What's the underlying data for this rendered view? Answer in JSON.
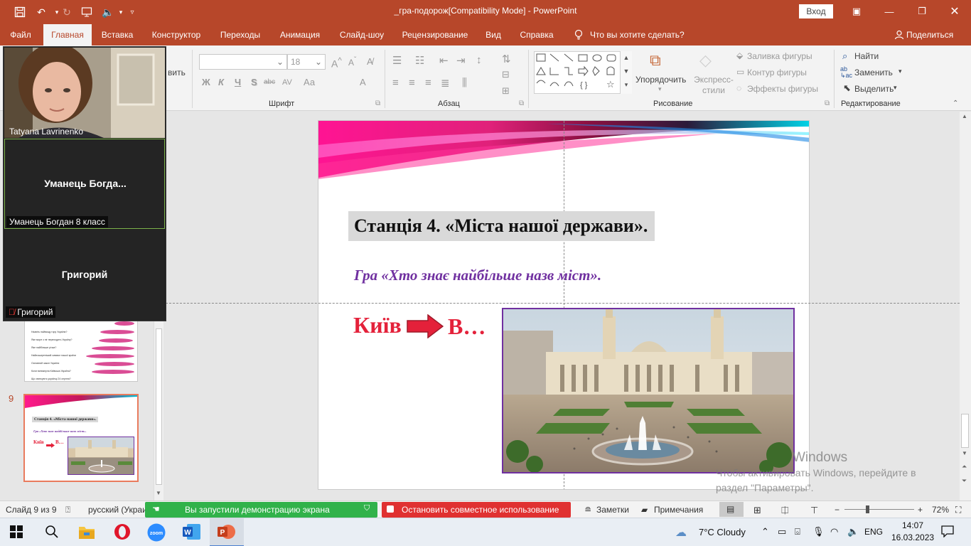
{
  "titlebar": {
    "title": "_гра-подорож[Compatibility Mode]  -  PowerPoint",
    "login": "Вход",
    "qat_icons": [
      "save-icon",
      "undo-icon",
      "redo-icon",
      "slideshow-icon",
      "audio-icon",
      "customize-icon"
    ],
    "window_controls": [
      "ribbon-display-icon",
      "minimize-icon",
      "restore-icon",
      "close-icon"
    ]
  },
  "menu": {
    "tabs": [
      "Файл",
      "Главная",
      "Вставка",
      "Конструктор",
      "Переходы",
      "Анимация",
      "Слайд-шоу",
      "Рецензирование",
      "Вид",
      "Справка"
    ],
    "active": "Главная",
    "tell_me": "Что вы хотите сделать?",
    "share": "Поделиться"
  },
  "ribbon": {
    "clipboard_partial": "вить",
    "font": {
      "label": "Шрифт",
      "font_name": "",
      "font_size": "18",
      "buttons": [
        "Ж",
        "К",
        "Ч",
        "S",
        "abc",
        "AV",
        "Аа",
        "A"
      ]
    },
    "paragraph": {
      "label": "Абзац"
    },
    "drawing": {
      "label": "Рисование",
      "arrange": "Упорядочить",
      "quick_styles": "Экспресс-стили",
      "fill": "Заливка фигуры",
      "outline": "Контур фигуры",
      "effects": "Эффекты фигуры"
    },
    "editing": {
      "label": "Редактирование",
      "find": "Найти",
      "replace": "Заменить",
      "select": "Выделить"
    }
  },
  "video": {
    "participants": [
      {
        "name": "Tatyana Lavrinenko",
        "display": ""
      },
      {
        "name": "Уманець Богдан 8 класс",
        "display": "Уманець  Богда..."
      },
      {
        "name": "Григорий",
        "display": "Григорий"
      }
    ]
  },
  "thumbnails": {
    "slide9_number": "9",
    "slide8_lines": [
      "Назвіть найвищу гору України?",
      "Яке море з ніг переходить Україну?",
      "Яке найбільше річка?",
      "Найпоширеніший символ нашої країни",
      "Основний закон України",
      "Коли виникнула Київська Україна?",
      "Що святкують українці 24 серпня?"
    ],
    "slide9_title": "Станція 4. «Міста нашої держави».",
    "slide9_subtitle": "Гра «Хто знає найбільше назв міст».",
    "slide9_word1": "Київ",
    "slide9_word2": "В…"
  },
  "slide": {
    "title": "Станція 4. «Міста нашої держави».",
    "subtitle": "Гра «Хто знає найбільше назв міст».",
    "word1": "Київ",
    "word2": "В…"
  },
  "watermark": {
    "line1": "Windows",
    "line2": "Чтобы активировать Windows, перейдите в",
    "line3": "раздел \"Параметры\"."
  },
  "statusbar": {
    "slide_info": "Слайд 9 из 9",
    "language": "русский (Украи",
    "sharing": "Вы запустили демонстрацию экрана",
    "stop_sharing": "Остановить совместное использование",
    "notes": "Заметки",
    "comments": "Примечания",
    "zoom": "72%"
  },
  "taskbar": {
    "weather": "7°C  Cloudy",
    "lang": "ENG",
    "time": "14:07",
    "date": "16.03.2023"
  },
  "colors": {
    "accent": "#b7472a",
    "slide_red": "#e4213a",
    "slide_purple": "#7030a0",
    "share_green": "#31b24a",
    "stop_red": "#e03131"
  }
}
